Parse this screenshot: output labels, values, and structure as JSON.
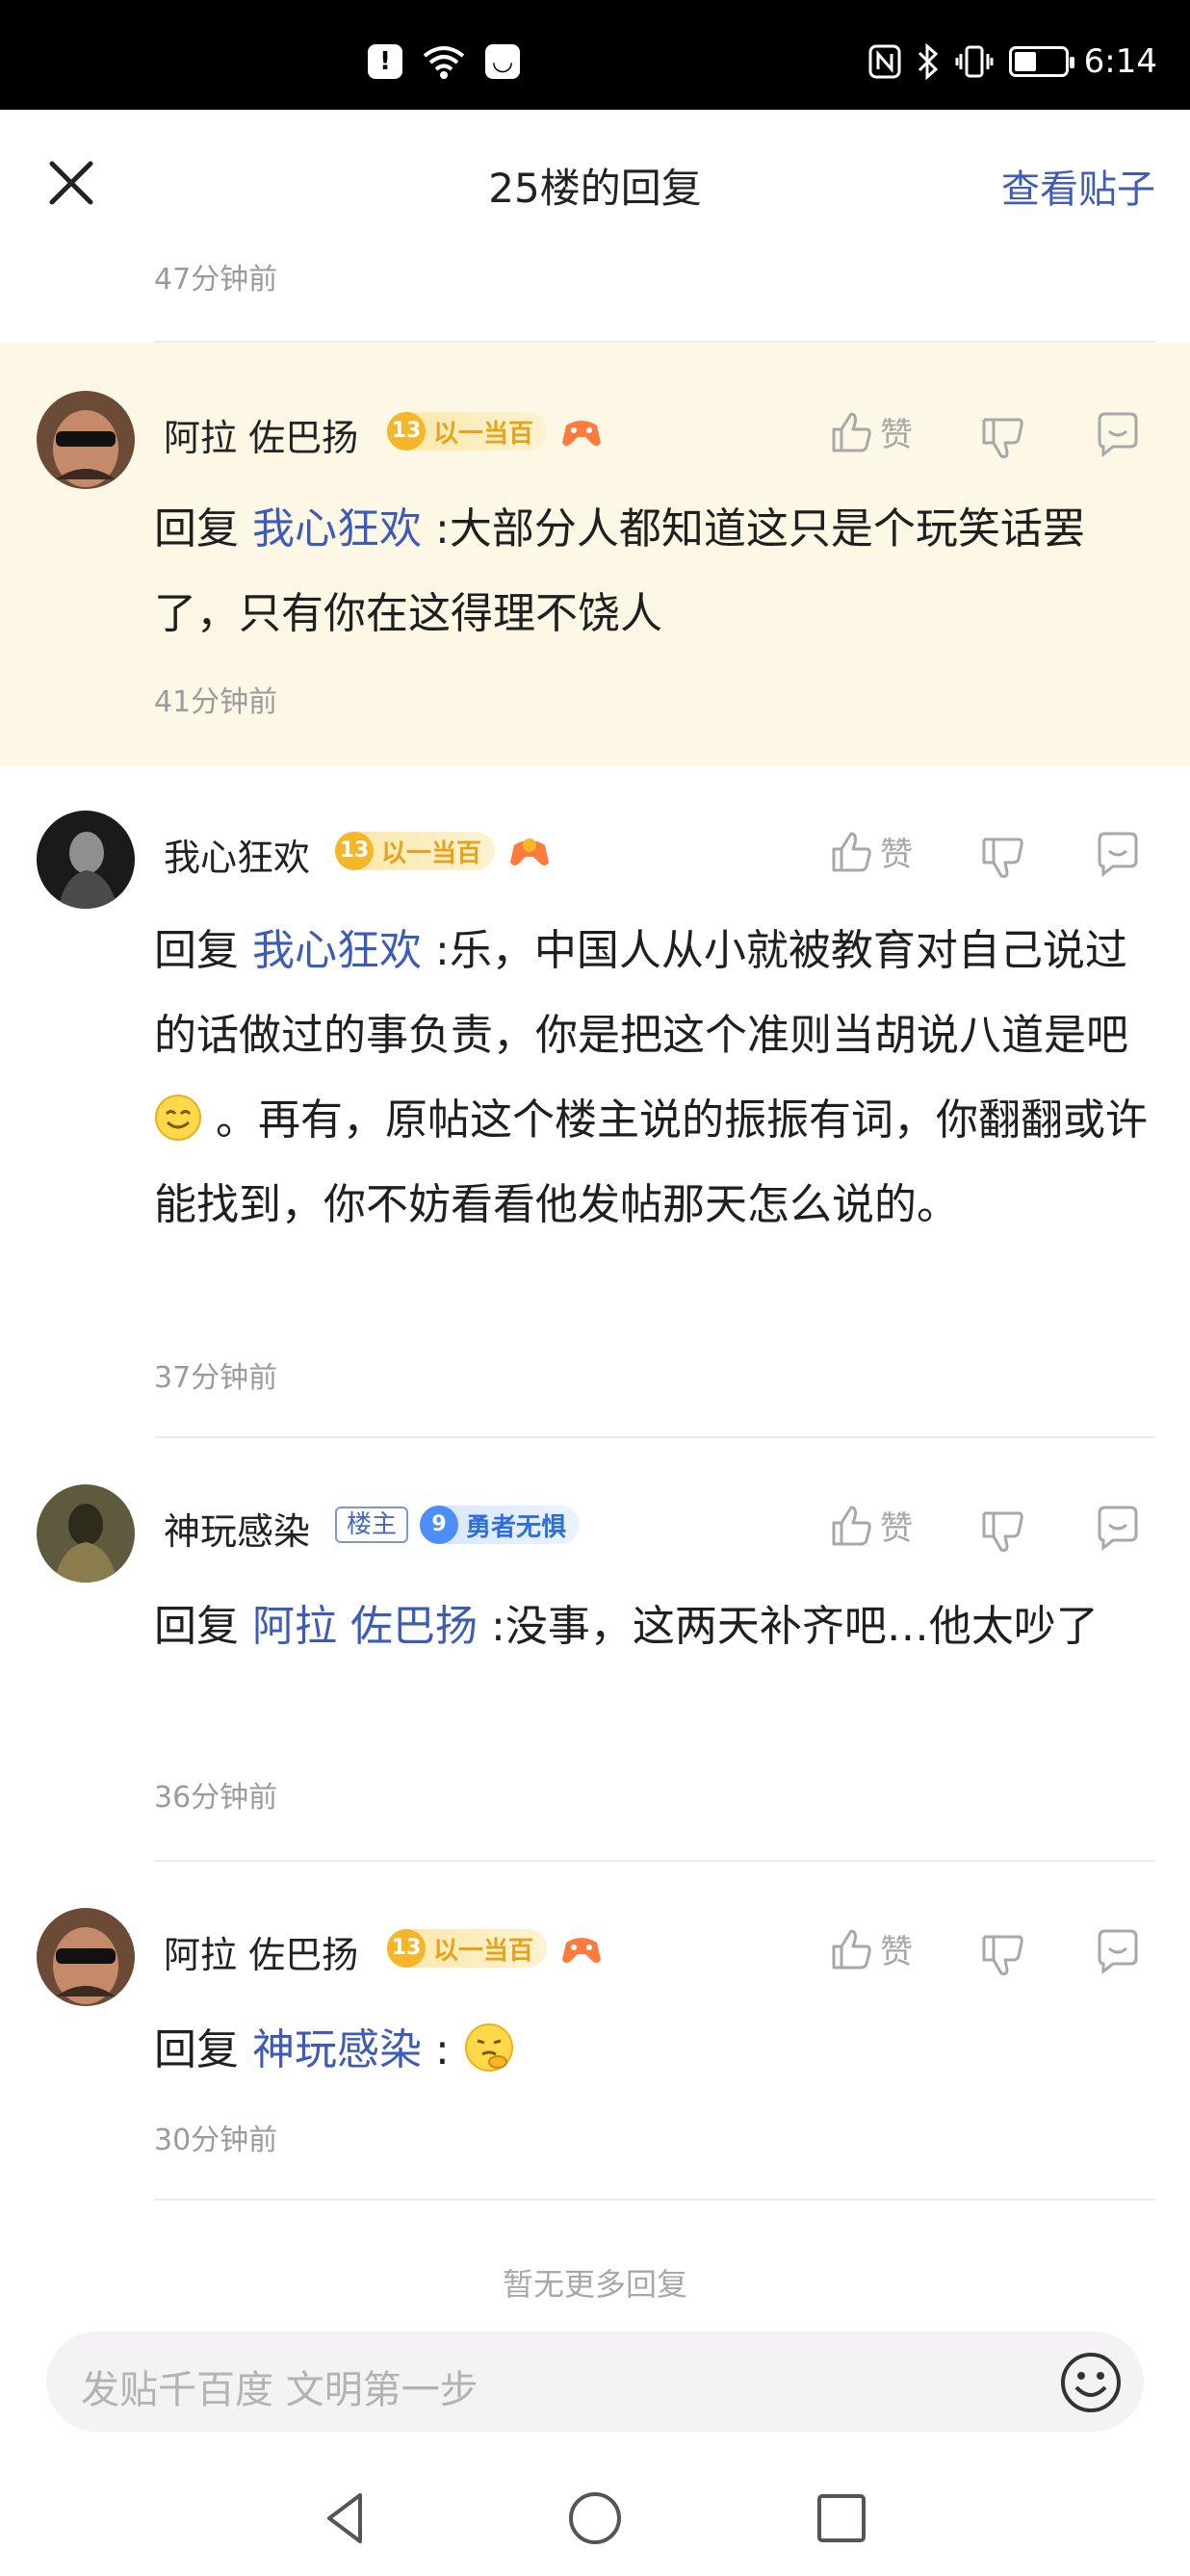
{
  "status_bar": {
    "time": "6:14",
    "battery_level": 0.45,
    "icons": [
      "alert-icon",
      "wifi-icon",
      "message-icon",
      "nfc-icon",
      "bluetooth-icon",
      "vibrate-icon",
      "battery-icon"
    ]
  },
  "header": {
    "title": "25楼的回复",
    "view_post": "查看贴子"
  },
  "top_time": "47分钟前",
  "replies": [
    {
      "user": "阿拉 佐巴扬",
      "level": "13",
      "level_title": "以一当百",
      "prefix": "回复",
      "mention": "我心狂欢",
      "text": ":大部分人都知道这只是个玩笑话罢了，只有你在这得理不饶人",
      "time": "41分钟前",
      "like_label": "赞"
    },
    {
      "user": "我心狂欢",
      "level": "13",
      "level_title": "以一当百",
      "prefix": "回复",
      "mention": "我心狂欢",
      "text_a": ":乐，中国人从小就被教育对自己说过的话做过的事负责，你是把这个准则当胡说八道是吧",
      "text_b": "。再有，原帖这个楼主说的振振有词，你翻翻或许能找到，你不妨看看他发帖那天怎么说的。",
      "time": "37分钟前",
      "like_label": "赞"
    },
    {
      "user": "神玩感染",
      "owner_tag": "楼主",
      "level": "9",
      "level_title": "勇者无惧",
      "prefix": "回复",
      "mention": "阿拉 佐巴扬",
      "text": ":没事，这两天补齐吧…他太吵了",
      "time": "36分钟前",
      "like_label": "赞"
    },
    {
      "user": "阿拉 佐巴扬",
      "level": "13",
      "level_title": "以一当百",
      "prefix": "回复",
      "mention": "神玩感染",
      "text": ":",
      "time": "30分钟前",
      "like_label": "赞"
    }
  ],
  "no_more": "暂无更多回复",
  "input": {
    "placeholder": "发贴千百度 文明第一步"
  },
  "colors": {
    "accent": "#3d5cb8",
    "highlight_bg": "#fdf7e6",
    "level_gold": "#f5b62a",
    "level_blue": "#4b8ef5"
  }
}
